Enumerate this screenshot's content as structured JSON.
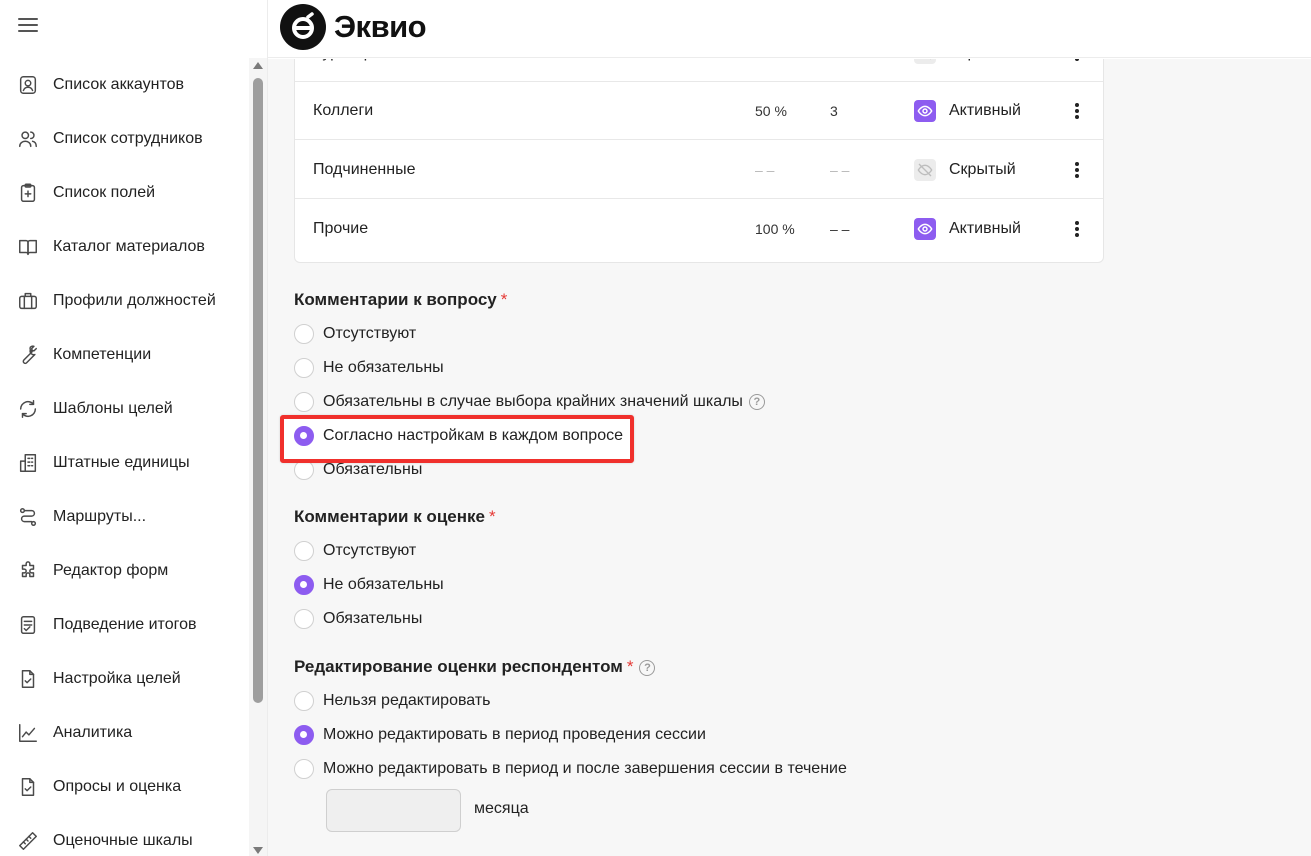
{
  "app": {
    "logo_text": "Эквио"
  },
  "sidebar": {
    "items": [
      {
        "label": "Список аккаунтов",
        "icon": "account-box-icon"
      },
      {
        "label": "Список сотрудников",
        "icon": "users-icon"
      },
      {
        "label": "Список полей",
        "icon": "clipboard-plus-icon"
      },
      {
        "label": "Каталог материалов",
        "icon": "book-open-icon"
      },
      {
        "label": "Профили должностей",
        "icon": "briefcase-icon"
      },
      {
        "label": "Компетенции",
        "icon": "wrench-icon"
      },
      {
        "label": "Шаблоны целей",
        "icon": "refresh-icon"
      },
      {
        "label": "Штатные единицы",
        "icon": "building-icon"
      },
      {
        "label": "Маршруты...",
        "icon": "route-icon"
      },
      {
        "label": "Редактор форм",
        "icon": "puzzle-icon"
      },
      {
        "label": "Подведение итогов",
        "icon": "checklist-icon"
      },
      {
        "label": "Настройка целей",
        "icon": "file-check-icon"
      },
      {
        "label": "Аналитика",
        "icon": "chart-line-icon"
      },
      {
        "label": "Опросы и оценка",
        "icon": "file-check-icon"
      },
      {
        "label": "Оценочные шкалы",
        "icon": "ruler-icon"
      }
    ]
  },
  "table": {
    "rows": [
      {
        "name": "Кураторы",
        "percent": "",
        "count": "",
        "status": "Скрытый",
        "status_icon": "eye-off-icon",
        "active": false
      },
      {
        "name": "Коллеги",
        "percent": "50 %",
        "count": "3",
        "status": "Активный",
        "status_icon": "eye-icon",
        "active": true
      },
      {
        "name": "Подчиненные",
        "percent": "– –",
        "count": "– –",
        "status": "Скрытый",
        "status_icon": "eye-off-icon",
        "active": false
      },
      {
        "name": "Прочие",
        "percent": "100 %",
        "count": "– –",
        "status": "Активный",
        "status_icon": "eye-icon",
        "active": true
      }
    ]
  },
  "question_comments": {
    "title": "Комментарии к вопросу",
    "required_mark": "*",
    "options": [
      {
        "label": "Отсутствуют",
        "checked": false
      },
      {
        "label": "Не обязательны",
        "checked": false
      },
      {
        "label": "Обязательны в случае выбора крайних значений шкалы",
        "checked": false,
        "help": "?"
      },
      {
        "label": "Согласно настройкам в каждом вопросе",
        "checked": true
      },
      {
        "label": "Обязательны",
        "checked": false
      }
    ]
  },
  "rating_comments": {
    "title": "Комментарии к оценке",
    "required_mark": "*",
    "options": [
      {
        "label": "Отсутствуют",
        "checked": false
      },
      {
        "label": "Не обязательны",
        "checked": true
      },
      {
        "label": "Обязательны",
        "checked": false
      }
    ]
  },
  "rating_editing": {
    "title": "Редактирование оценки респондентом",
    "required_mark": "*",
    "help": "?",
    "options": [
      {
        "label": "Нельзя редактировать",
        "checked": false
      },
      {
        "label": "Можно редактировать в период проведения сессии",
        "checked": true
      },
      {
        "label": "Можно редактировать в период и после завершения сессии в течение",
        "checked": false
      }
    ],
    "months_value": "",
    "months_label": "месяца"
  },
  "colors": {
    "accent": "#8d5cf0",
    "highlight": "#f0302c",
    "required": "#e53935"
  }
}
